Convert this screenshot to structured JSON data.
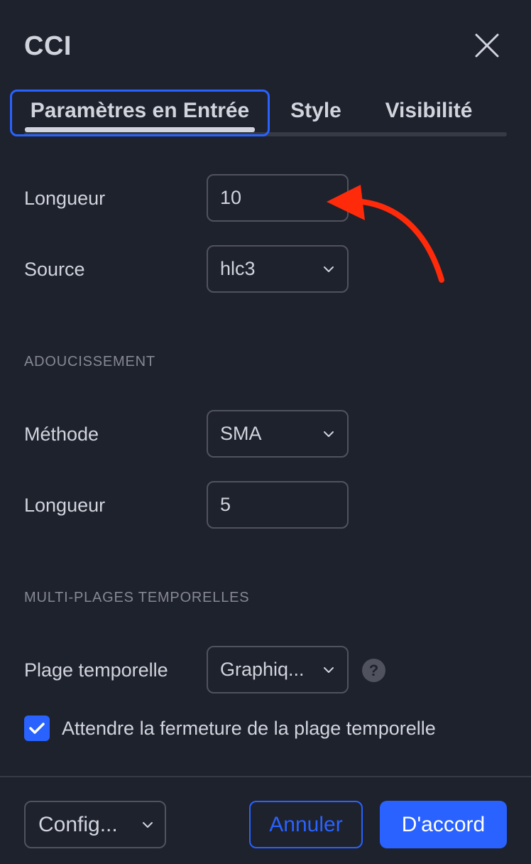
{
  "dialog": {
    "title": "CCI"
  },
  "tabs": [
    {
      "label": "Paramètres en Entrée",
      "active": true
    },
    {
      "label": "Style",
      "active": false
    },
    {
      "label": "Visibilité",
      "active": false
    }
  ],
  "inputs": {
    "length_label": "Longueur",
    "length_value": "10",
    "source_label": "Source",
    "source_value": "hlc3"
  },
  "smoothing": {
    "header": "ADOUCISSEMENT",
    "method_label": "Méthode",
    "method_value": "SMA",
    "length_label": "Longueur",
    "length_value": "5"
  },
  "multi_timeframe": {
    "header": "MULTI-PLAGES TEMPORELLES",
    "timeframe_label": "Plage temporelle",
    "timeframe_value": "Graphiq...",
    "help_glyph": "?",
    "wait_close_label": "Attendre la fermeture de la plage temporelle",
    "wait_close_checked": true
  },
  "footer": {
    "defaults_value": "Config...",
    "cancel_label": "Annuler",
    "ok_label": "D'accord"
  },
  "colors": {
    "background": "#1e222d",
    "accent": "#2962ff",
    "annotation_arrow": "#ff2a0a"
  }
}
